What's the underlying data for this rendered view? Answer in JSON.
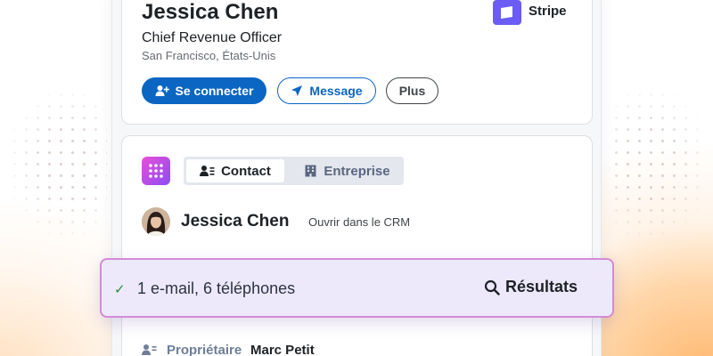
{
  "profile": {
    "name": "Jessica Chen",
    "title": "Chief Revenue Officer",
    "location": "San Francisco, États-Unis",
    "company": "Stripe",
    "buttons": {
      "connect": "Se connecter",
      "message": "Message",
      "more": "Plus"
    }
  },
  "crm": {
    "tabs": [
      {
        "label": "Contact",
        "icon": "contact-card-icon",
        "selected": true
      },
      {
        "label": "Entreprise",
        "icon": "building-icon",
        "selected": false
      }
    ],
    "contact_name": "Jessica Chen",
    "open_link": "Ouvrir dans le CRM",
    "result_text": "1 e-mail, 6 téléphones",
    "result_button": "Résultats",
    "owner_label": "Propriétaire",
    "owner_value": "Marc Petit"
  },
  "colors": {
    "linkedin_blue": "#0a66c2",
    "stripe_purple": "#6b5cf6",
    "result_bg": "#ede9fb",
    "result_border": "#d38bd6",
    "check_green": "#2d8a3e"
  }
}
